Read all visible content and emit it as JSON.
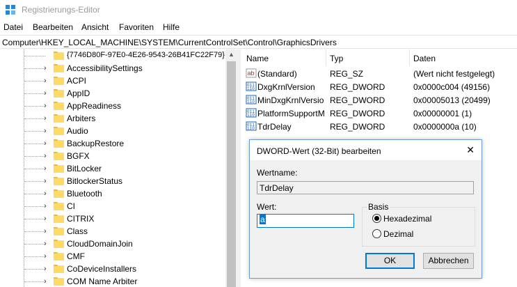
{
  "window": {
    "title": "Registrierungs-Editor"
  },
  "menu": [
    "Datei",
    "Bearbeiten",
    "Ansicht",
    "Favoriten",
    "Hilfe"
  ],
  "address": "Computer\\HKEY_LOCAL_MACHINE\\SYSTEM\\CurrentControlSet\\Control\\GraphicsDrivers",
  "tree": {
    "items": [
      "{7746D80F-97E0-4E26-9543-26B41FC22F79}",
      "AccessibilitySettings",
      "ACPI",
      "AppID",
      "AppReadiness",
      "Arbiters",
      "Audio",
      "BackupRestore",
      "BGFX",
      "BitLocker",
      "BitlockerStatus",
      "Bluetooth",
      "CI",
      "CITRIX",
      "Class",
      "CloudDomainJoin",
      "CMF",
      "CoDeviceInstallers",
      "COM Name Arbiter"
    ]
  },
  "list": {
    "headers": {
      "name": "Name",
      "type": "Typ",
      "data": "Daten"
    },
    "rows": [
      {
        "name": "(Standard)",
        "type": "REG_SZ",
        "data": "(Wert nicht festgelegt)",
        "icon": "string-value-icon"
      },
      {
        "name": "DxgKrnlVersion",
        "type": "REG_DWORD",
        "data": "0x0000c004 (49156)",
        "icon": "binary-value-icon"
      },
      {
        "name": "MinDxgKrnlVersion",
        "type": "REG_DWORD",
        "data": "0x00005013 (20499)",
        "icon": "binary-value-icon"
      },
      {
        "name": "PlatformSupportMiracast",
        "type": "REG_DWORD",
        "data": "0x00000001 (1)",
        "icon": "binary-value-icon"
      },
      {
        "name": "TdrDelay",
        "type": "REG_DWORD",
        "data": "0x0000000a (10)",
        "icon": "binary-value-icon"
      }
    ]
  },
  "dialog": {
    "title": "DWORD-Wert (32-Bit) bearbeiten",
    "name_label": "Wertname:",
    "name_value": "TdrDelay",
    "value_label": "Wert:",
    "value": "a",
    "base_label": "Basis",
    "hex_label": "Hexadezimal",
    "dec_label": "Dezimal",
    "selected_base": "Hexadezimal",
    "ok_label": "OK",
    "cancel_label": "Abbrechen"
  },
  "colors": {
    "accent": "#0078d7",
    "folder": "#ffd966",
    "dialog_bg": "#f0f0f0"
  }
}
